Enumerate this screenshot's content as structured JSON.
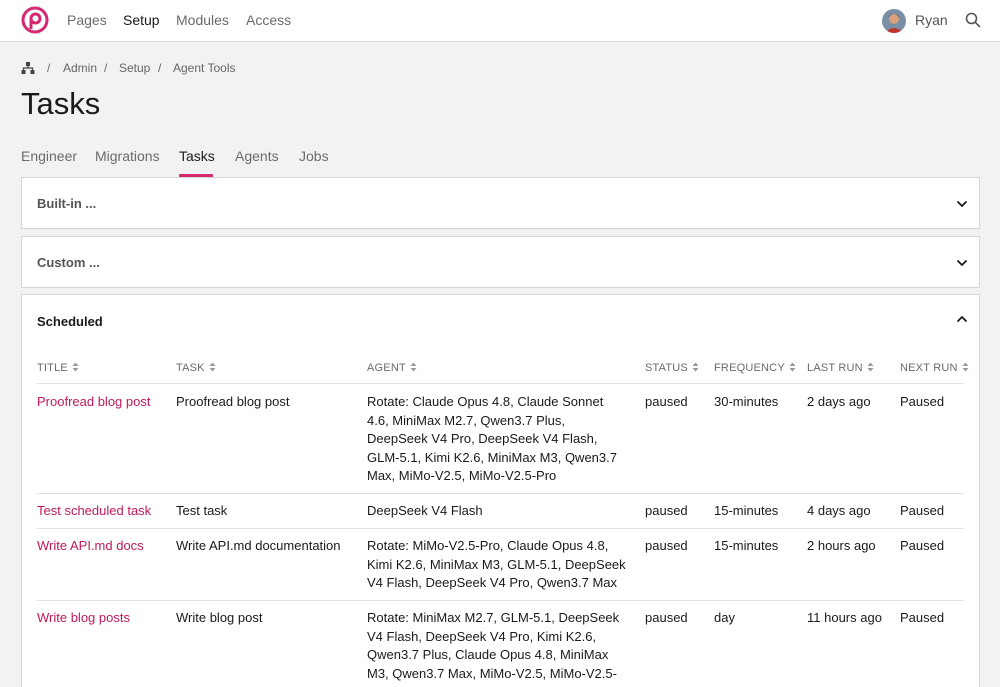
{
  "nav": {
    "items": [
      "Pages",
      "Setup",
      "Modules",
      "Access"
    ],
    "active": "Setup",
    "user_name": "Ryan"
  },
  "breadcrumb": [
    "Admin",
    "Agent Tools"
  ],
  "breadcrumb_middle": "Setup",
  "breadcrumb_sep": "/",
  "page_title": "Tasks",
  "tabs": [
    "Engineer",
    "Migrations",
    "Tasks",
    "Agents",
    "Jobs"
  ],
  "active_tab": "Tasks",
  "panels": {
    "builtin": "Built-in ...",
    "custom": "Custom ...",
    "scheduled": "Scheduled"
  },
  "table": {
    "headers": [
      "TITLE",
      "TASK",
      "AGENT",
      "STATUS",
      "FREQUENCY",
      "LAST RUN",
      "NEXT RUN"
    ],
    "rows": [
      {
        "title": "Proofread blog post",
        "task": "Proofread blog post",
        "agent_lines": [
          "Rotate: Claude Opus 4.8, Claude Sonnet",
          "4.6, MiniMax M2.7, Qwen3.7 Plus,",
          "DeepSeek V4 Pro, DeepSeek V4 Flash,",
          "GLM-5.1, Kimi K2.6, MiniMax M3, Qwen3.7",
          "Max, MiMo-V2.5, MiMo-V2.5-Pro"
        ],
        "status": "paused",
        "frequency": "30-minutes",
        "last_run": "2 days ago",
        "next_run": "Paused"
      },
      {
        "title": "Test scheduled task",
        "task": "Test task",
        "agent_lines": [
          "DeepSeek V4 Flash"
        ],
        "status": "paused",
        "frequency": "15-minutes",
        "last_run": "4 days ago",
        "next_run": "Paused"
      },
      {
        "title": "Write API.md docs",
        "task": "Write API.md documentation",
        "agent_lines": [
          "Rotate: MiMo-V2.5-Pro, Claude Opus 4.8,",
          "Kimi K2.6, MiniMax M3, GLM-5.1, DeepSeek",
          "V4 Flash, DeepSeek V4 Pro, Qwen3.7 Max"
        ],
        "status": "paused",
        "frequency": "15-minutes",
        "last_run": "2 hours ago",
        "next_run": "Paused"
      },
      {
        "title": "Write blog posts",
        "task": "Write blog post",
        "agent_lines": [
          "Rotate: MiniMax M2.7, GLM-5.1, DeepSeek",
          "V4 Flash, DeepSeek V4 Pro, Kimi K2.6,",
          "Qwen3.7 Plus, Claude Opus 4.8, MiniMax",
          "M3, Qwen3.7 Max, MiMo-V2.5, MiMo-V2.5-"
        ],
        "status": "paused",
        "frequency": "day",
        "last_run": "11 hours ago",
        "next_run": "Paused"
      }
    ]
  },
  "colors": {
    "accent": "#d4286f",
    "link": "#c2185b",
    "background": "#f2f2f2"
  },
  "icons": [
    "logo-icon",
    "avatar",
    "search-icon",
    "sitemap-icon",
    "chevron-down-icon",
    "chevron-up-icon",
    "sort-icon"
  ]
}
